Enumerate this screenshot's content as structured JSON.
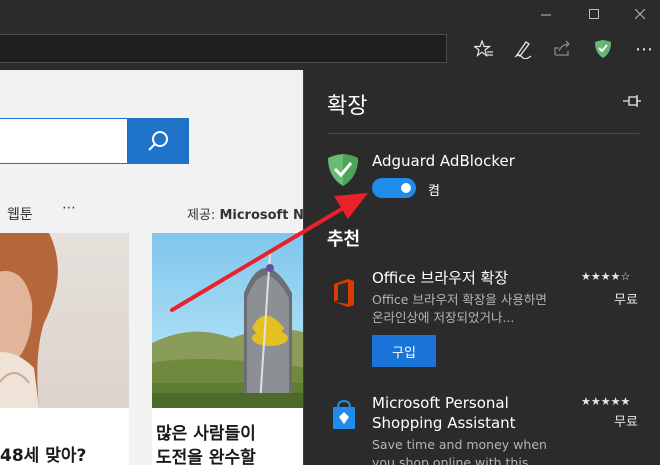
{
  "window": {
    "minimize_glyph": "—",
    "maximize_glyph": "☐",
    "close_glyph": "✕"
  },
  "toolbar": {
    "icons": [
      "favorites-star-icon",
      "pen-notes-icon",
      "share-icon",
      "adguard-shield-icon",
      "more-icon"
    ],
    "more_glyph": "⋯"
  },
  "webpage": {
    "nav_item": "웹툰",
    "nav_more": "⋯",
    "provider_prefix": "제공: ",
    "provider_name": "Microsoft N",
    "card1_title": "48세 맞아?",
    "card2_title_line1": "많은 사람들이 ",
    "card2_title_line2": "도전을 완수할"
  },
  "panel": {
    "title": "확장",
    "installed": {
      "name": "Adguard AdBlocker",
      "toggle_label": "켬",
      "enabled": true
    },
    "section_title": "추천",
    "recommendations": [
      {
        "name": "Office 브라우저 확장",
        "description": "Office 브라우저 확장을 사용하면 온라인상에 저장되었거나...",
        "stars": "★★★★☆",
        "rating": 4,
        "price": "무료",
        "button": "구입"
      },
      {
        "name_line1": "Microsoft Personal",
        "name_line2": "Shopping Assistant",
        "description": "Save time and money when you shop online with this",
        "stars": "★★★★★",
        "rating": 4.5,
        "price": "무료"
      }
    ]
  },
  "colors": {
    "panel_bg": "#2b2b2b",
    "accent_blue": "#1e8ce8",
    "adguard_green": "#68bc71",
    "office_red": "#d83b01",
    "arrow_red": "#e8212a"
  }
}
